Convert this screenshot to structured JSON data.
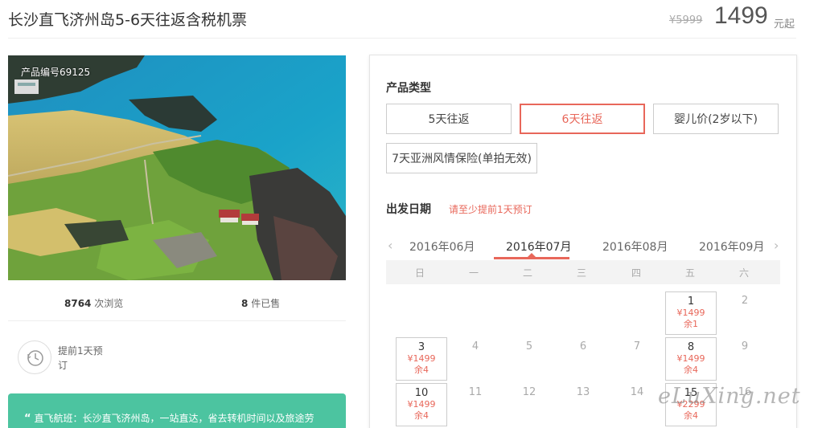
{
  "product": {
    "title": "长沙直飞济州岛5-6天往返含税机票",
    "old_price": "¥5999",
    "price": "1499",
    "price_unit": "元起",
    "code": "产品编号69125"
  },
  "stats": {
    "views_num": "8764",
    "views_label": "次浏览",
    "sold_num": "8",
    "sold_label": "件已售"
  },
  "advance": {
    "text": "提前1天预订"
  },
  "notice": {
    "quote": "“",
    "text": "直飞航班：长沙直飞济州岛，一站直达，省去转机时间以及旅途劳"
  },
  "panel": {
    "type_label": "产品类型",
    "options": [
      {
        "label": "5天往返",
        "active": false
      },
      {
        "label": "6天往返",
        "active": true
      },
      {
        "label": "婴儿价(2岁以下)",
        "active": false
      },
      {
        "label": "7天亚洲风情保险(单拍无效)",
        "active": false
      }
    ],
    "date_label": "出发日期",
    "date_hint": "请至少提前1天预订",
    "months": [
      "2016年06月",
      "2016年07月",
      "2016年08月",
      "2016年09月"
    ],
    "active_month": 1,
    "prev_arrow": "‹",
    "next_arrow": "›",
    "weekdays": [
      "日",
      "一",
      "二",
      "三",
      "四",
      "五",
      "六"
    ],
    "days": [
      {
        "num": "1",
        "price": "¥1499",
        "stock": "余1"
      },
      {
        "num": "2"
      },
      {
        "num": "3",
        "price": "¥1499",
        "stock": "余4"
      },
      {
        "num": "4"
      },
      {
        "num": "5"
      },
      {
        "num": "6"
      },
      {
        "num": "7"
      },
      {
        "num": "8",
        "price": "¥1499",
        "stock": "余4"
      },
      {
        "num": "9"
      },
      {
        "num": "10",
        "price": "¥1499",
        "stock": "余4"
      },
      {
        "num": "11"
      },
      {
        "num": "12"
      },
      {
        "num": "13"
      },
      {
        "num": "14"
      },
      {
        "num": "15",
        "price": "¥2299",
        "stock": "余4"
      },
      {
        "num": "16"
      }
    ]
  },
  "watermark": "eLuXing.net"
}
